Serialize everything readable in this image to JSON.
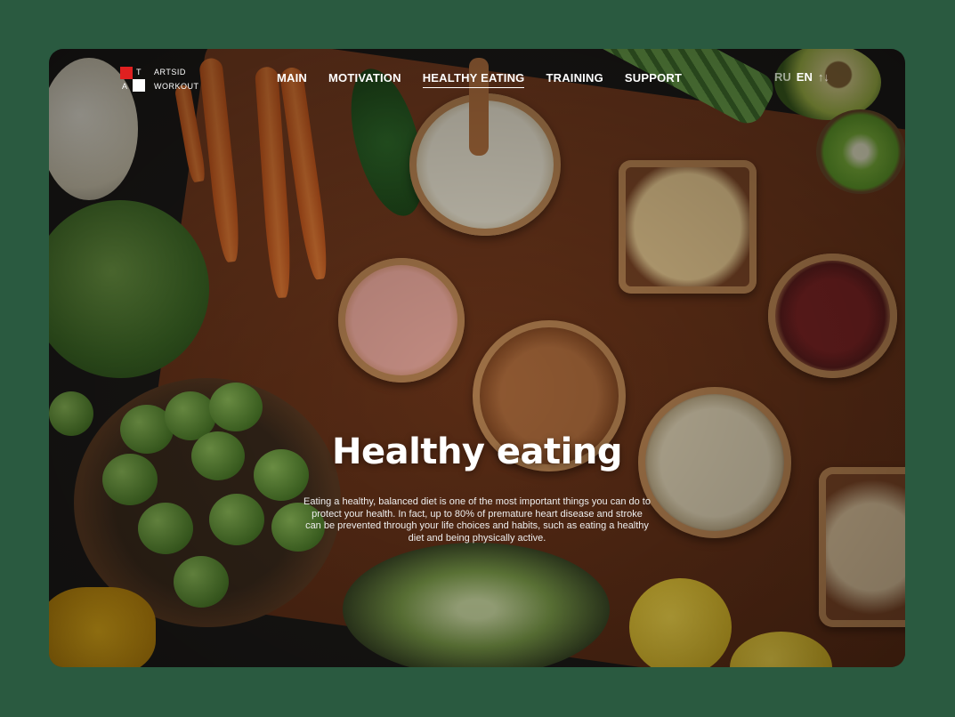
{
  "logo": {
    "letters": [
      "T",
      "A"
    ],
    "lines": [
      "ARTSID",
      "WORKOUT"
    ],
    "square_colors": [
      "#e02020",
      "#ffffff"
    ]
  },
  "nav": {
    "items": [
      {
        "label": "MAIN",
        "active": false
      },
      {
        "label": "MOTIVATION",
        "active": false
      },
      {
        "label": "HEALTHY EATING",
        "active": true
      },
      {
        "label": "TRAINING",
        "active": false
      },
      {
        "label": "SUPPORT",
        "active": false
      }
    ]
  },
  "lang": {
    "ru": "RU",
    "en": "EN",
    "toggle": "↑↓"
  },
  "hero": {
    "title": "Healthy eating",
    "text": "Eating a healthy, balanced diet is one of the most important things you can do to protect your health. In fact, up to 80% of premature heart disease and stroke can be prevented through your life choices and habits, such as eating a healthy diet and being physically active."
  },
  "colors": {
    "background": "#2a5a40",
    "board": "#6a3419",
    "accent": "#e02020"
  }
}
